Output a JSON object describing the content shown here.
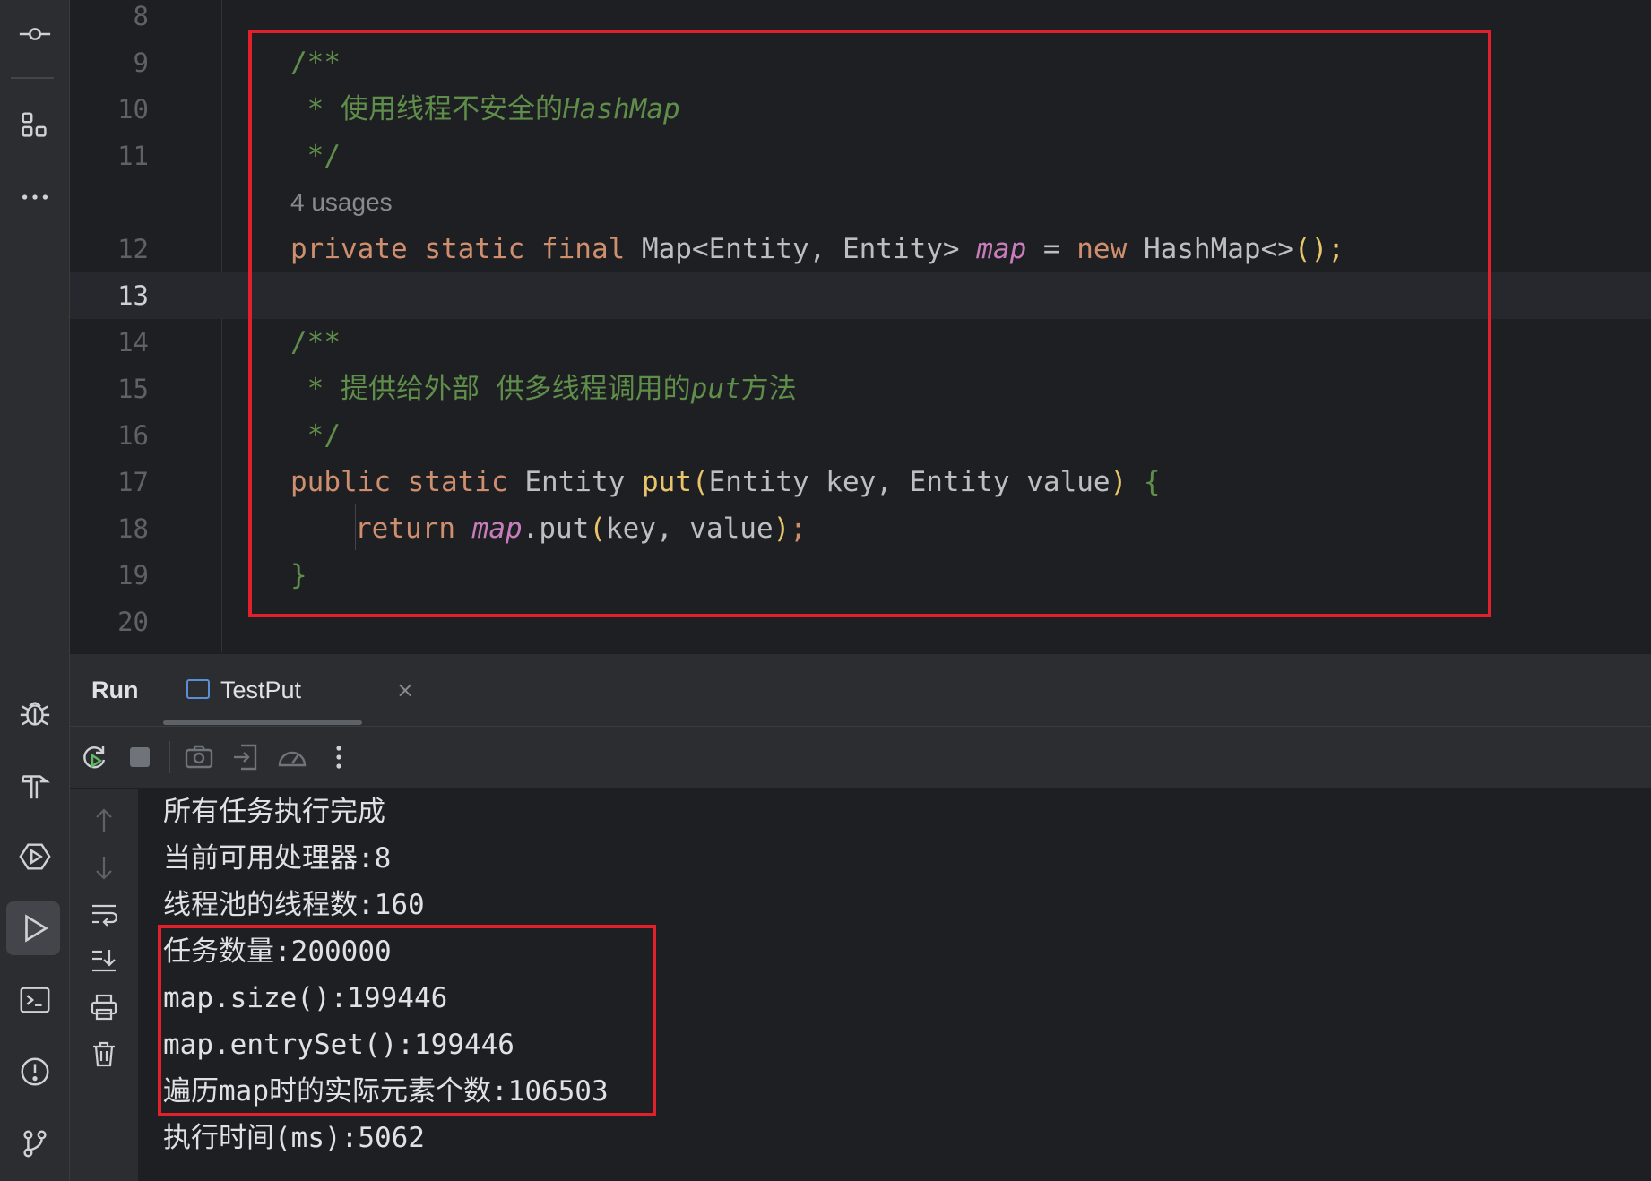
{
  "editor": {
    "lines": [
      {
        "num": "8"
      },
      {
        "num": "9"
      },
      {
        "num": "10"
      },
      {
        "num": "11"
      },
      {
        "num": "12"
      },
      {
        "num": "13"
      },
      {
        "num": "14"
      },
      {
        "num": "15"
      },
      {
        "num": "16"
      },
      {
        "num": "17"
      },
      {
        "num": "18"
      },
      {
        "num": "19"
      },
      {
        "num": "20"
      }
    ],
    "current_line": "13",
    "usages_hint": "4 usages",
    "comment1_open": "/**",
    "comment1_body_prefix": " * 使用线程不安全的",
    "comment1_body_italic": "HashMap",
    "comment1_close": " */",
    "field_decl": {
      "kw1": "private",
      "kw2": "static",
      "kw3": "final",
      "type": "Map<Entity, Entity>",
      "name": "map",
      "eq": " = ",
      "kw_new": "new",
      "ctor": "HashMap<>",
      "tail": "();"
    },
    "comment2_open": "/**",
    "comment2_body_prefix": " * 提供给外部 供多线程调用的",
    "comment2_body_italic": "put",
    "comment2_body_suffix": "方法",
    "comment2_close": " */",
    "method_decl": {
      "kw1": "public",
      "kw2": "static",
      "ret": "Entity",
      "name": "put",
      "params": "Entity key, Entity value",
      "brace": "{"
    },
    "return_stmt": {
      "kw": "return",
      "field": "map",
      "call": ".put",
      "args": "key, value",
      "end": ";"
    },
    "close_brace": "}"
  },
  "run_panel": {
    "title": "Run",
    "tab_label": "TestPut",
    "tab_close": "×",
    "output": [
      "所有任务执行完成",
      "当前可用处理器:8",
      "线程池的线程数:160",
      "任务数量:200000",
      "map.size():199446",
      "map.entrySet():199446",
      "遍历map时的实际元素个数:106503",
      "执行时间(ms):5062"
    ]
  },
  "colors": {
    "highlight_box": "#e0202a",
    "keyword": "#cf8e6d",
    "comment": "#5f8e4a",
    "field": "#c77dbb",
    "method": "#e8c46a"
  },
  "icons": {
    "strip": [
      "commit-icon",
      "structure-icon",
      "more-icon",
      "debug-icon",
      "build-icon",
      "services-icon",
      "run-icon",
      "terminal-icon",
      "problems-icon",
      "git-icon"
    ],
    "toolbar": [
      "rerun-icon",
      "stop-icon",
      "screenshot-icon",
      "restore-layout-icon",
      "profiler-icon",
      "more-vertical-icon"
    ],
    "side": [
      "scroll-up-icon",
      "scroll-down-icon",
      "soft-wrap-icon",
      "scroll-to-end-icon",
      "print-icon",
      "clear-icon"
    ]
  }
}
